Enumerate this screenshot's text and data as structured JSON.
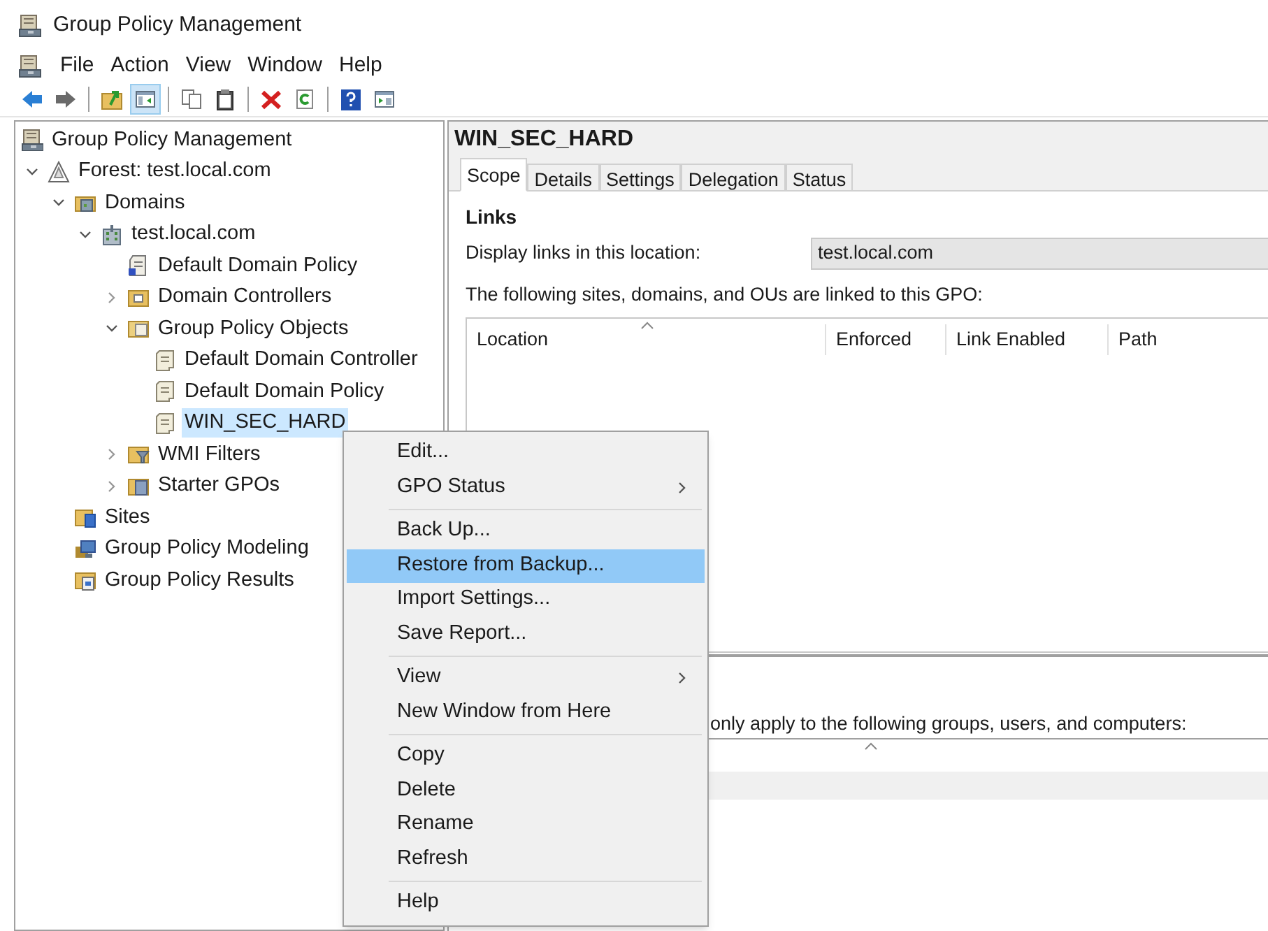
{
  "window": {
    "title": "Group Policy Management"
  },
  "menu_bar": [
    "File",
    "Action",
    "View",
    "Window",
    "Help"
  ],
  "toolbar": [
    {
      "kind": "back",
      "pressed": false
    },
    {
      "kind": "forward",
      "pressed": false
    },
    {
      "kind": "separator"
    },
    {
      "kind": "up",
      "pressed": false
    },
    {
      "kind": "tree-toggle",
      "pressed": true
    },
    {
      "kind": "separator"
    },
    {
      "kind": "copy",
      "pressed": false
    },
    {
      "kind": "paste",
      "pressed": false
    },
    {
      "kind": "separator"
    },
    {
      "kind": "delete",
      "pressed": false
    },
    {
      "kind": "refresh",
      "pressed": false
    },
    {
      "kind": "separator"
    },
    {
      "kind": "help",
      "pressed": false
    },
    {
      "kind": "properties",
      "pressed": false
    }
  ],
  "tree": {
    "label": "Group Policy Management",
    "kind": "console",
    "selected": false,
    "children": [
      {
        "label": "Forest: test.local.com",
        "kind": "forest",
        "expanded": true,
        "selected": false,
        "children": [
          {
            "label": "Domains",
            "kind": "domains",
            "expanded": true,
            "selected": false,
            "children": [
              {
                "label": "test.local.com",
                "kind": "domain",
                "expanded": true,
                "selected": false,
                "children": [
                  {
                    "label": "Default Domain Policy",
                    "kind": "gpo-link",
                    "selected": false
                  },
                  {
                    "label": "Domain Controllers",
                    "kind": "ou",
                    "expanded": false,
                    "selected": false
                  },
                  {
                    "label": "Group Policy Objects",
                    "kind": "folder",
                    "expanded": true,
                    "selected": false,
                    "children": [
                      {
                        "label": "Default Domain Controller",
                        "kind": "gpo",
                        "selected": false
                      },
                      {
                        "label": "Default Domain Policy",
                        "kind": "gpo",
                        "selected": false
                      },
                      {
                        "label": "WIN_SEC_HARD",
                        "kind": "gpo",
                        "selected": true
                      }
                    ]
                  },
                  {
                    "label": "WMI Filters",
                    "kind": "filter",
                    "expanded": false,
                    "selected": false
                  },
                  {
                    "label": "Starter GPOs",
                    "kind": "starter",
                    "expanded": false,
                    "selected": false
                  }
                ]
              }
            ]
          },
          {
            "label": "Sites",
            "kind": "sites",
            "selected": false
          },
          {
            "label": "Group Policy Modeling",
            "kind": "modeling",
            "selected": false
          },
          {
            "label": "Group Policy Results",
            "kind": "results",
            "selected": false
          }
        ]
      }
    ]
  },
  "details": {
    "title": "WIN_SEC_HARD",
    "tabs": [
      {
        "label": "Scope",
        "selected": true
      },
      {
        "label": "Details",
        "selected": false
      },
      {
        "label": "Settings",
        "selected": false
      },
      {
        "label": "Delegation",
        "selected": false
      },
      {
        "label": "Status",
        "selected": false
      }
    ],
    "links_heading": "Links",
    "location_label": "Display links in this location:",
    "location_value": "test.local.com",
    "links_description": "The following sites, domains, and OUs are linked to this GPO:",
    "links_columns": [
      "Location",
      "Enforced",
      "Link Enabled",
      "Path"
    ],
    "filtering_description": "only apply to the following groups, users, and computers:"
  },
  "context_menu": {
    "sections": [
      [
        {
          "label": "Edit...",
          "submenu": false,
          "selected": false
        },
        {
          "label": "GPO Status",
          "submenu": true,
          "selected": false
        }
      ],
      [
        {
          "label": "Back Up...",
          "submenu": false,
          "selected": false
        },
        {
          "label": "Restore from Backup...",
          "submenu": false,
          "selected": true
        },
        {
          "label": "Import Settings...",
          "submenu": false,
          "selected": false
        },
        {
          "label": "Save Report...",
          "submenu": false,
          "selected": false
        }
      ],
      [
        {
          "label": "View",
          "submenu": true,
          "selected": false
        },
        {
          "label": "New Window from Here",
          "submenu": false,
          "selected": false
        }
      ],
      [
        {
          "label": "Copy",
          "submenu": false,
          "selected": false
        },
        {
          "label": "Delete",
          "submenu": false,
          "selected": false
        },
        {
          "label": "Rename",
          "submenu": false,
          "selected": false
        },
        {
          "label": "Refresh",
          "submenu": false,
          "selected": false
        }
      ],
      [
        {
          "label": "Help",
          "submenu": false,
          "selected": false
        }
      ]
    ]
  }
}
